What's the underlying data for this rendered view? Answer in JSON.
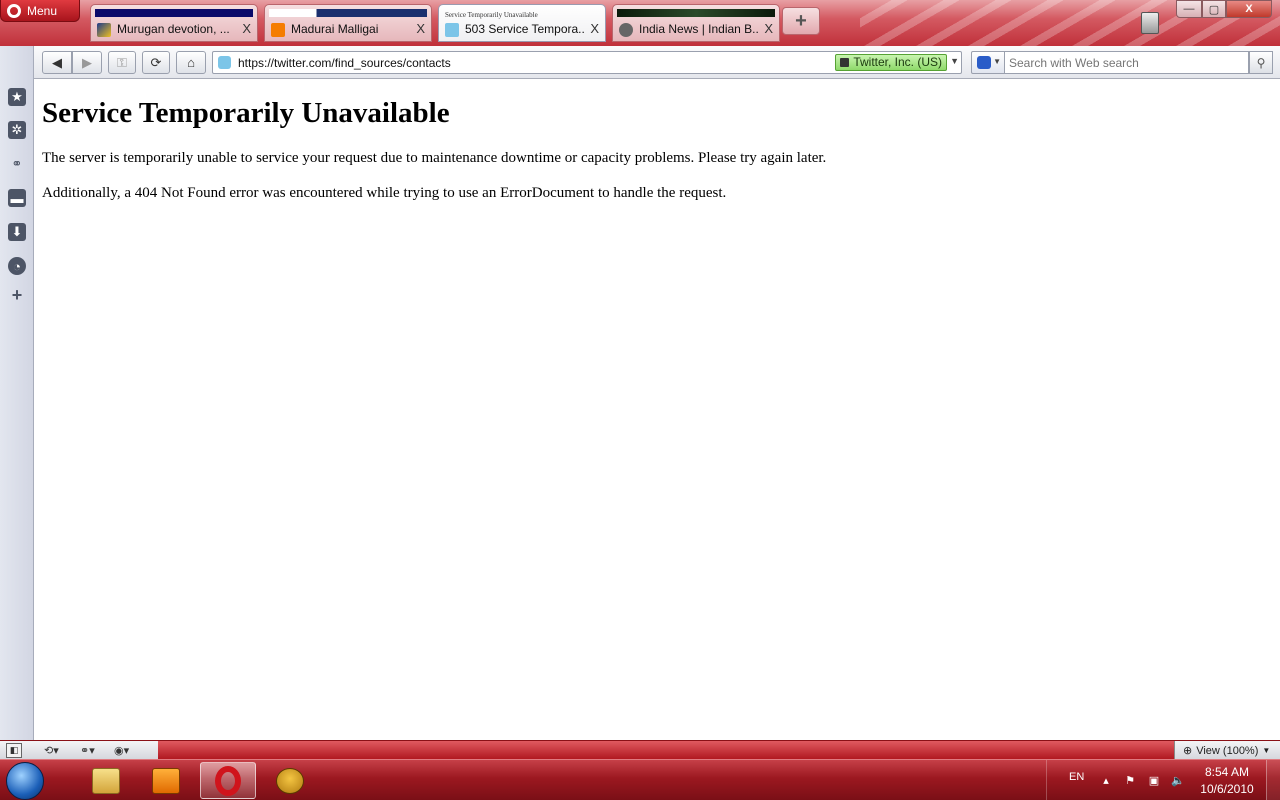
{
  "browser": {
    "menu_label": "Menu",
    "tabs": [
      {
        "label": "Murugan devotion, ...",
        "active": false
      },
      {
        "label": "Madurai Malligai",
        "active": false
      },
      {
        "label": "503 Service Tempora...",
        "active": true,
        "header_text": "Service Temporarily Unavailable"
      },
      {
        "label": "India News | Indian B...",
        "active": false
      }
    ],
    "tab_close_glyph": "X",
    "new_tab_glyph": "+",
    "window_controls": {
      "minimize": "—",
      "maximize": "▢",
      "close": "X"
    }
  },
  "toolbar": {
    "back_icon": "back-arrow-icon",
    "forward_icon": "forward-arrow-icon",
    "address": "https://twitter.com/find_sources/contacts",
    "security_badge": "Twitter, Inc. (US)",
    "search_placeholder": "Search with Web search"
  },
  "page": {
    "heading": "Service Temporarily Unavailable",
    "paragraph_1": "The server is temporarily unable to service your request due to maintenance downtime or capacity problems. Please try again later.",
    "paragraph_2": "Additionally, a 404 Not Found error was encountered while trying to use an ErrorDocument to handle the request."
  },
  "statusbar": {
    "zoom_label": "View (100%)"
  },
  "taskbar": {
    "language": "EN",
    "time": "8:54 AM",
    "date": "10/6/2010"
  },
  "colors": {
    "browser_accent": "#c0303a",
    "security_green": "#8ed96a"
  }
}
